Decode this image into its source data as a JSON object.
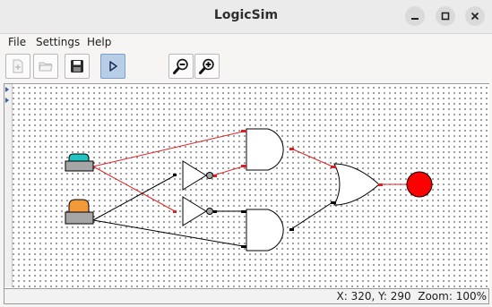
{
  "window": {
    "title": "LogicSim",
    "controls": [
      "minimize-icon",
      "maximize-icon",
      "close-icon"
    ]
  },
  "menu": {
    "items": [
      {
        "label": "File"
      },
      {
        "label": "Settings"
      },
      {
        "label": "Help"
      }
    ]
  },
  "toolbar": {
    "buttons": [
      {
        "icon": "new-file-icon",
        "enabled": false
      },
      {
        "icon": "open-folder-icon",
        "enabled": false
      },
      {
        "icon": "save-icon",
        "enabled": true
      },
      {
        "icon": "play-icon",
        "enabled": true,
        "active": true
      },
      {
        "icon": "zoom-out-icon",
        "enabled": true
      },
      {
        "icon": "zoom-in-icon",
        "enabled": true
      }
    ]
  },
  "circuit": {
    "inputs": [
      {
        "name": "switch-a",
        "state": "on",
        "color": "#20c4c4"
      },
      {
        "name": "switch-b",
        "state": "off",
        "color": "#f29a3a"
      }
    ],
    "gates": [
      "not-gate-1",
      "not-gate-2",
      "and-gate-top",
      "and-gate-bottom",
      "or-gate"
    ],
    "output": {
      "name": "output-lamp",
      "state": "on",
      "color": "#ff0000"
    },
    "colors": {
      "active_wire": "#e02020",
      "inactive_wire": "#000000"
    }
  },
  "status": {
    "text": "X: 320, Y: 290  Zoom: 100%"
  }
}
